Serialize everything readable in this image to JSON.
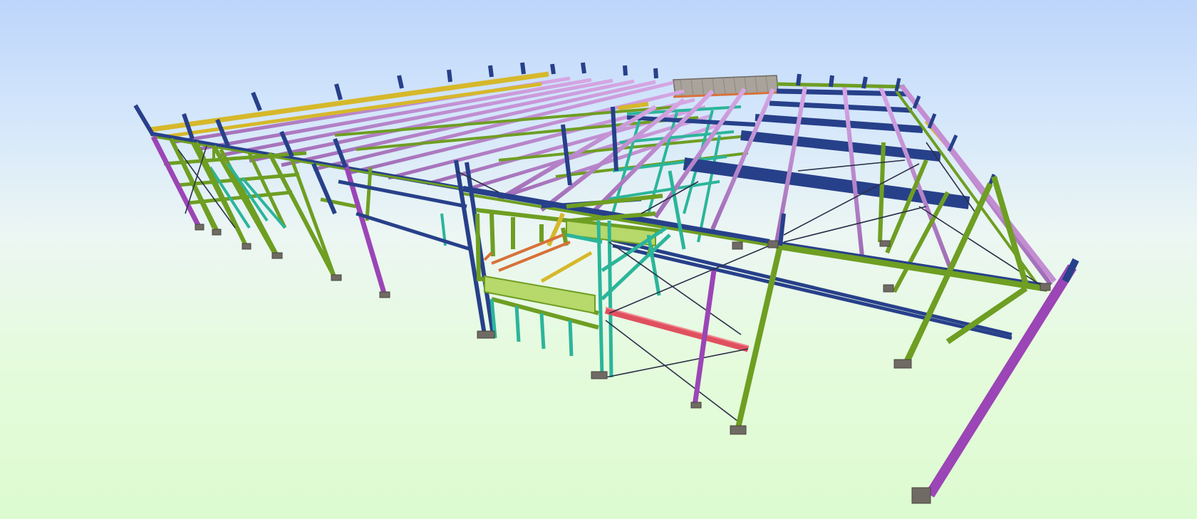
{
  "viewport": {
    "background_top": "#bdd5fb",
    "background_bottom": "#dcfbd0"
  },
  "model": {
    "kind": "3D structural steel frame",
    "member_colors": {
      "column_green": "#6e9e22",
      "column_purple": "#9b45b6",
      "column_navy": "#27408a",
      "beam_navy": "#27408a",
      "purlin_lilac": "#c38dd2",
      "beam_yellow": "#d6b82a",
      "frame_teal": "#2bb59a",
      "frame_orange": "#d8713a",
      "beam_red": "#e0505e",
      "panel_lime": "#b7d86a",
      "bracing_dark": "#2a2f48",
      "deck_grey": "#a9a39b"
    }
  }
}
